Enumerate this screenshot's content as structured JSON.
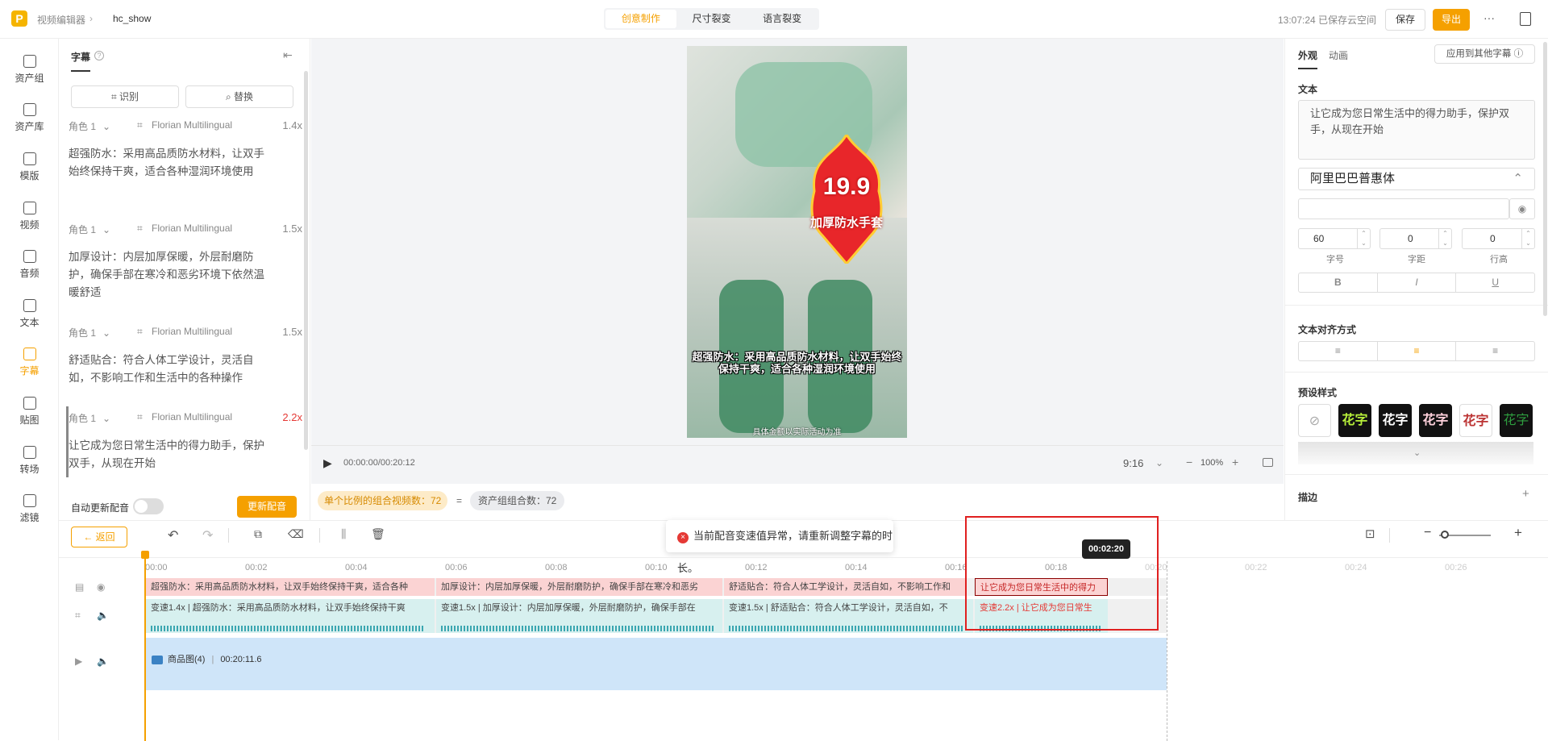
{
  "topbar": {
    "breadcrumb_root": "视频编辑器",
    "breadcrumb_current": "hc_show",
    "modes": [
      "创意制作",
      "尺寸裂变",
      "语言裂变"
    ],
    "save_status": "13:07:24 已保存云空间",
    "save_label": "保存",
    "export_label": "导出",
    "more": "···"
  },
  "leftnav": {
    "items": [
      {
        "label": "资产组",
        "icon": "folder-icon"
      },
      {
        "label": "资产库",
        "icon": "asset-library-icon"
      },
      {
        "label": "模版",
        "icon": "template-icon"
      },
      {
        "label": "视频",
        "icon": "video-icon"
      },
      {
        "label": "音频",
        "icon": "audio-icon"
      },
      {
        "label": "文本",
        "icon": "text-icon"
      },
      {
        "label": "字幕",
        "icon": "subtitle-icon"
      },
      {
        "label": "贴图",
        "icon": "sticker-icon"
      },
      {
        "label": "转场",
        "icon": "transition-icon"
      },
      {
        "label": "滤镜",
        "icon": "filter-icon"
      }
    ],
    "active_index": 6
  },
  "subtitle_panel": {
    "tab": "字幕",
    "recognize_label": "识别",
    "replace_label": "替换",
    "items": [
      {
        "role": "角色 1",
        "voice": "Florian Multilingual",
        "speed": "1.4x",
        "text": "超强防水：采用高品质防水材料，让双手始终保持干爽，适合各种湿润环境使用"
      },
      {
        "role": "角色 1",
        "voice": "Florian Multilingual",
        "speed": "1.5x",
        "text": "加厚设计：内层加厚保暖，外层耐磨防护，确保手部在寒冷和恶劣环境下依然温暖舒适"
      },
      {
        "role": "角色 1",
        "voice": "Florian Multilingual",
        "speed": "1.5x",
        "text": "舒适贴合：符合人体工学设计，灵活自如，不影响工作和生活中的各种操作"
      },
      {
        "role": "角色 1",
        "voice": "Florian Multilingual",
        "speed": "2.2x",
        "text": "让它成为您日常生活中的得力助手，保护双手，从现在开始"
      }
    ],
    "auto_dub_label": "自动更新配音",
    "update_dub_label": "更新配音"
  },
  "preview": {
    "price": "19.9",
    "product_label": "加厚防水手套",
    "caption": "超强防水：采用高品质防水材料，让双手始终保持干爽，适合各种湿润环境使用",
    "disclaimer": "具体金额以实际活动为准",
    "time": "00:00:00/00:20:12",
    "ratio": "9:16",
    "zoom": "100%",
    "combo_label": "单个比例的组合视频数：72",
    "equals": "=",
    "asset_combo_label": "资产组组合数：72"
  },
  "rightpanel": {
    "tabs": [
      "外观",
      "动画"
    ],
    "apply_label": "应用到其他字幕",
    "text_section": "文本",
    "text_value": "让它成为您日常生活中的得力助手，保护双手，从现在开始",
    "font": "阿里巴巴普惠体",
    "size": "60",
    "spacing": "0",
    "line": "0",
    "size_label": "字号",
    "spacing_label": "字距",
    "line_label": "行高",
    "bold": "B",
    "italic": "I",
    "underline": "U",
    "align_section": "文本对齐方式",
    "preset_section": "预设样式",
    "preset_text": "花字",
    "stroke_section": "描边",
    "plus": "+"
  },
  "timeline": {
    "back_label": "返回",
    "warning": "当前配音变速值异常，请重新调整字幕的时长。",
    "tooltip": "00:02:20",
    "ruler": [
      "00:00",
      "00:02",
      "00:04",
      "00:06",
      "00:08",
      "00:10",
      "00:12",
      "00:14",
      "00:16",
      "00:18",
      "00:20",
      "00:22",
      "00:24",
      "00:26"
    ],
    "subtitle_clips": [
      "超强防水：采用高品质防水材料，让双手始终保持干爽，适合各种",
      "加厚设计：内层加厚保暖，外层耐磨防护，确保手部在寒冷和恶劣",
      "舒适贴合：符合人体工学设计，灵活自如，不影响工作和",
      "让它成为您日常生活中的得力"
    ],
    "audio_clips": [
      {
        "speed": "变速1.4x",
        "text": "超强防水：采用高品质防水材料，让双手始终保持干爽"
      },
      {
        "speed": "变速1.5x",
        "text": "加厚设计：内层加厚保暖，外层耐磨防护，确保手部在"
      },
      {
        "speed": "变速1.5x",
        "text": "舒适贴合：符合人体工学设计，灵活自如，不"
      },
      {
        "speed": "变速2.2x",
        "text": "让它成为您日常生"
      }
    ],
    "video_clip_name": "商品图(4)",
    "video_clip_duration": "00:20:11.6",
    "colors": {
      "accent": "#f5a000",
      "warn": "#e53935",
      "subtitle_track": "#fbd3d3",
      "audio_track": "#d7f0ef",
      "video_track": "#cfe5f9"
    }
  }
}
